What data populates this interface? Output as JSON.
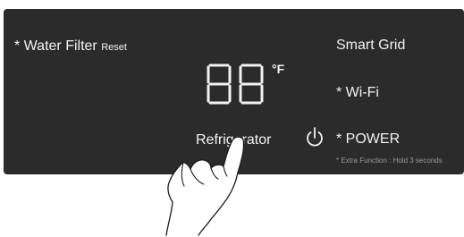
{
  "panel": {
    "water_filter_label": "* Water Filter",
    "reset_label": "Reset",
    "smart_grid_label": "Smart Grid",
    "wifi_label": "* Wi-Fi",
    "power_label": "* POWER",
    "extra_function_note": "* Extra Function : Hold 3 seconds",
    "refrigerator_label": "Refrigerator",
    "temperature_display": "88",
    "temperature_unit": "°F"
  },
  "icons": {
    "power": "power-icon",
    "hand": "pointing-hand-icon"
  },
  "colors": {
    "panel_background": "#2b2b2b",
    "text": "#f2f2f2",
    "note_text": "#9a9a9a"
  }
}
